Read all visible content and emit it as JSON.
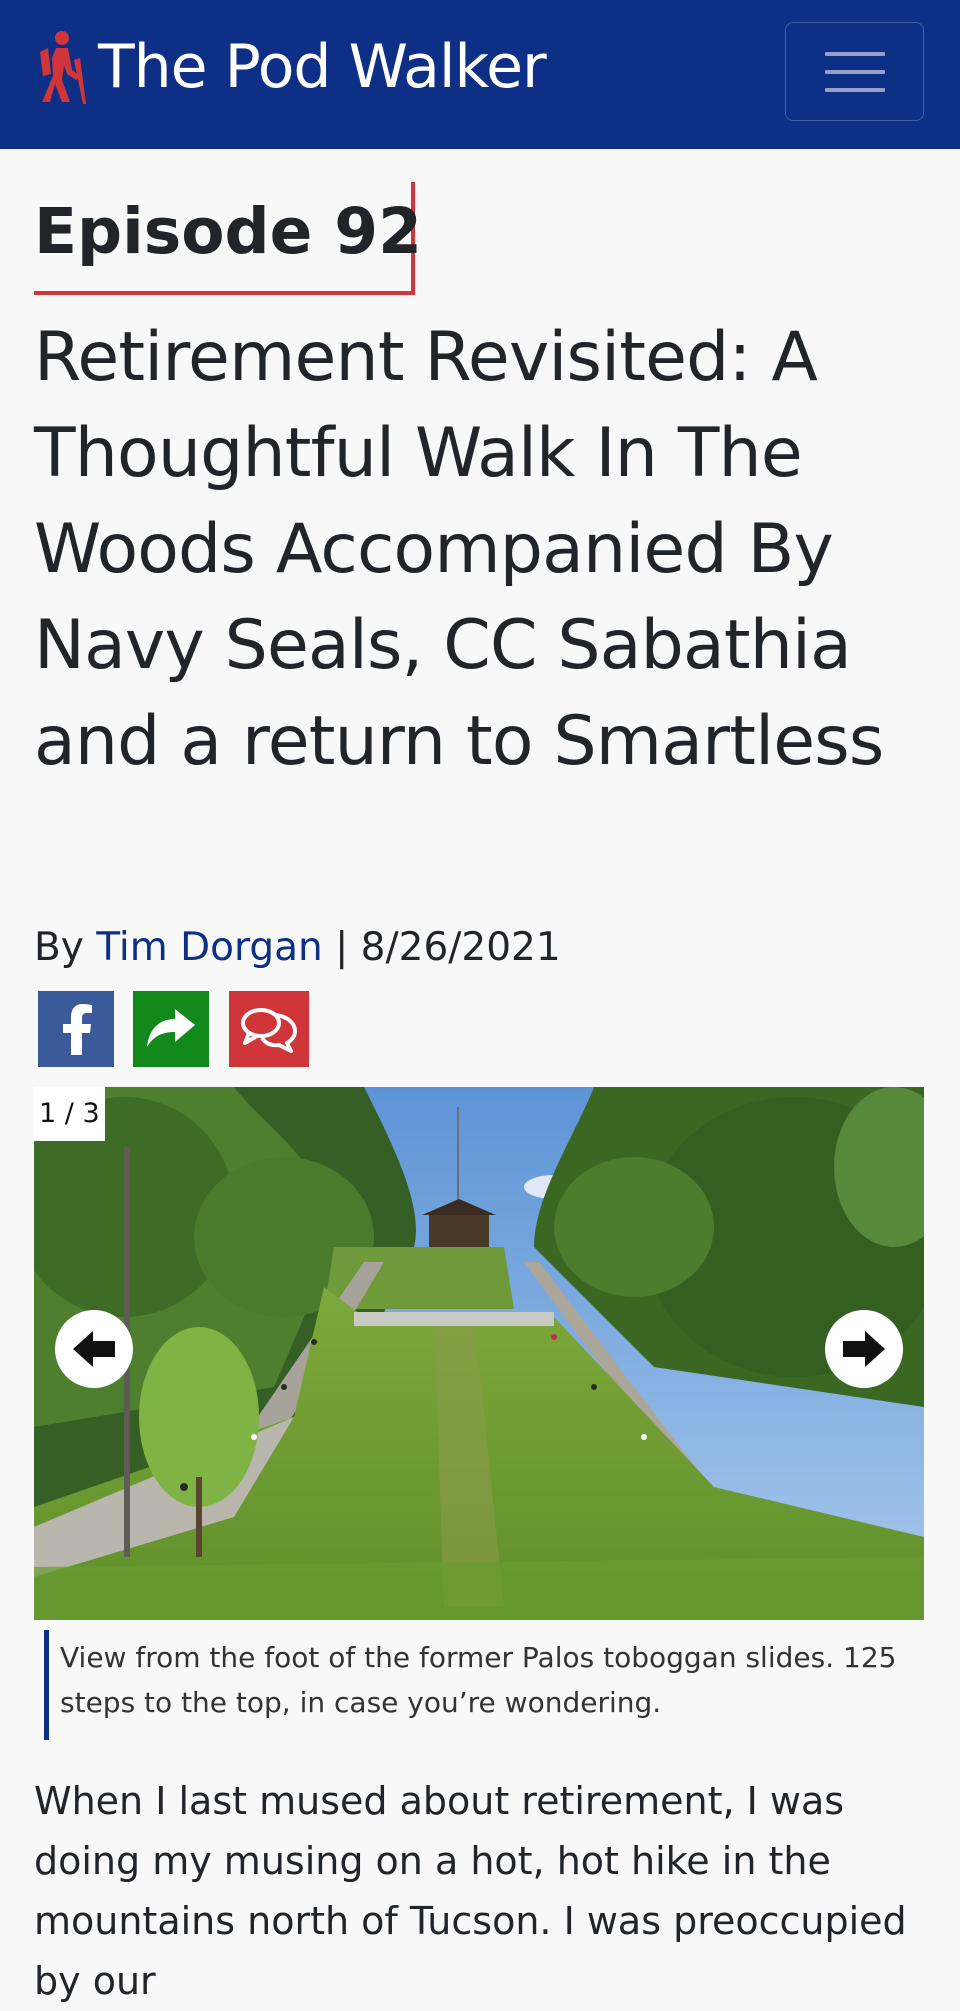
{
  "header": {
    "brand_name": "The Pod Walker",
    "brand_icon": "hiker-icon",
    "menu_icon": "hamburger-menu-icon",
    "colors": {
      "navbar": "#0e2f86",
      "brand_icon": "#d0353a"
    }
  },
  "article": {
    "episode_label": "Episode 92",
    "title": "Retirement Revisited: A Thoughtful Walk In The Woods Accompanied By Navy Seals, CC Sabathia and a return to Smartless",
    "byline_prefix": "By",
    "author": "Tim Dorgan",
    "byline_separator": "|",
    "date": "8/26/2021"
  },
  "share": {
    "buttons": [
      {
        "icon": "facebook-icon",
        "color": "#3a5a9a"
      },
      {
        "icon": "share-forward-icon",
        "color": "#118a1b"
      },
      {
        "icon": "comments-icon",
        "color": "#d0353a"
      }
    ]
  },
  "gallery": {
    "counter": "1 / 3",
    "prev_icon": "arrow-left-circle-icon",
    "next_icon": "arrow-right-circle-icon",
    "caption": "View from the foot of the former Palos toboggan slides. 125 steps to the top, in case you’re wondering."
  },
  "body": {
    "paragraph": "When I last mused about retirement, I was doing my musing on a hot, hot hike in the mountains north of Tucson. I was preoccupied by our"
  }
}
